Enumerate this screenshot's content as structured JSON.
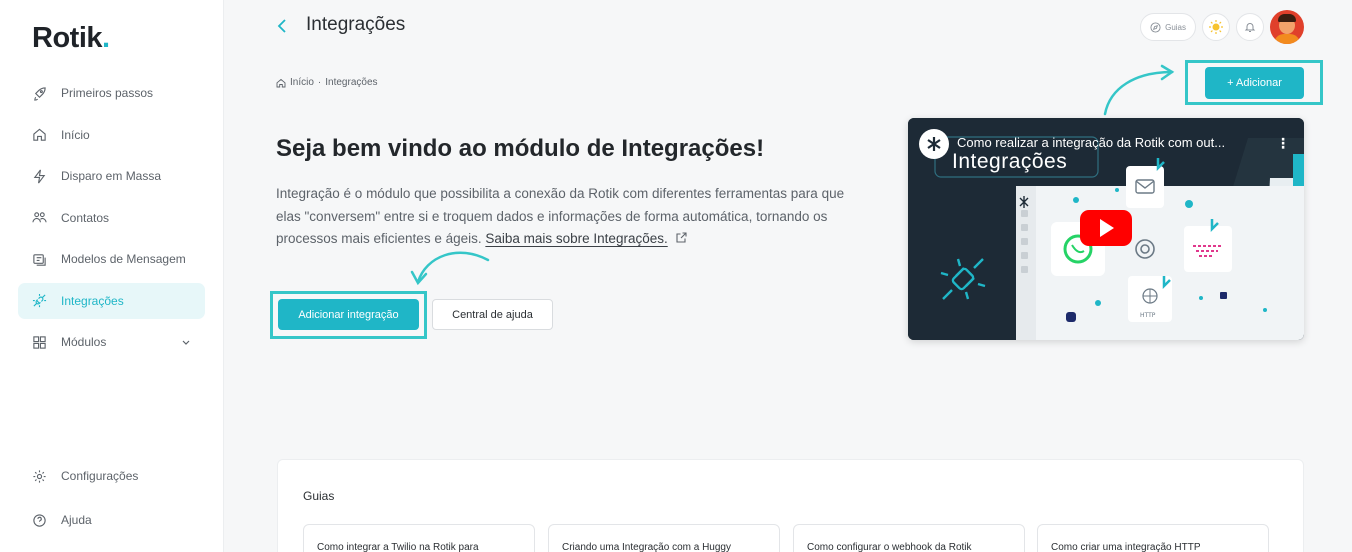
{
  "brand": {
    "name": "Rotik",
    "dot": "."
  },
  "sidebar": {
    "items": [
      {
        "label": "Primeiros passos",
        "icon": "rocket-icon"
      },
      {
        "label": "Início",
        "icon": "home-icon"
      },
      {
        "label": "Disparo em Massa",
        "icon": "lightning-icon"
      },
      {
        "label": "Contatos",
        "icon": "contacts-icon"
      },
      {
        "label": "Modelos de Mensagem",
        "icon": "message-template-icon"
      },
      {
        "label": "Integrações",
        "icon": "plug-icon",
        "active": true
      },
      {
        "label": "Módulos",
        "icon": "grid-icon"
      }
    ],
    "bottom": [
      {
        "label": "Configurações",
        "icon": "gear-icon"
      },
      {
        "label": "Ajuda",
        "icon": "help-icon"
      }
    ]
  },
  "header": {
    "title": "Integrações",
    "guides_label": "Guias"
  },
  "breadcrumb": {
    "home": "Início",
    "separator": "·",
    "current": "Integrações"
  },
  "add_button": {
    "label": "+ Adicionar"
  },
  "hero": {
    "title": "Seja bem vindo ao módulo de Integrações!",
    "description": "Integração é o módulo que possibilita a conexão da Rotik com diferentes ferramentas para que elas \"conversem\" entre si e troquem dados e informações de forma automática, tornando os processos mais eficientes e ágeis.",
    "link": "Saiba mais sobre Integrações.",
    "primary_button": "Adicionar integração",
    "secondary_button": "Central de ajuda"
  },
  "video": {
    "title": "Como realizar a integração da Rotik com out...",
    "subtitle": "Integrações",
    "badge": "HTTP"
  },
  "guides": {
    "title": "Guias",
    "cards": [
      "Como integrar a Twilio na Rotik para",
      "Criando uma Integração com a Huggy",
      "Como configurar o webhook da Rotik",
      "Como criar uma integração HTTP"
    ]
  },
  "colors": {
    "accent": "#1fb6c7",
    "highlight": "#35c6c8",
    "youtube": "#ff0000"
  }
}
